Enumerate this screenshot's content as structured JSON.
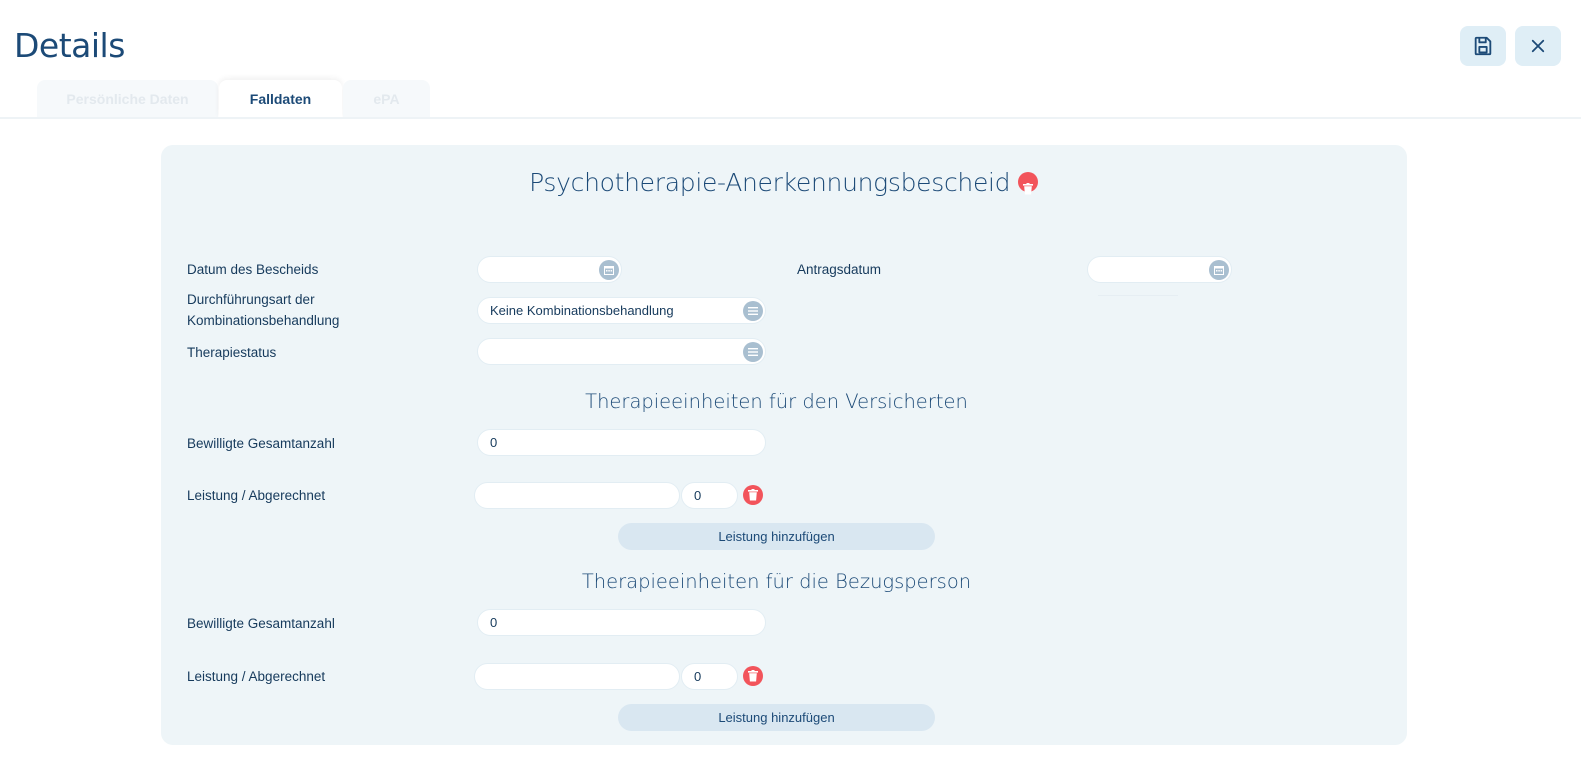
{
  "header": {
    "title": "Details",
    "save_icon": "save-icon",
    "close_icon": "close-icon"
  },
  "tabs": [
    {
      "label": "Persönliche Daten",
      "active": false
    },
    {
      "label": "Falldaten",
      "active": true
    },
    {
      "label": "ePA",
      "active": false
    }
  ],
  "form": {
    "title": "Psychotherapie-Anerkennungsbescheid",
    "fields": {
      "datum_label": "Datum des Bescheids",
      "datum_value": "",
      "antrag_label": "Antragsdatum",
      "antrag_value": "",
      "durchfuehrung_label_1": "Durchführungsart der",
      "durchfuehrung_label_2": "Kombinationsbehandlung",
      "durchfuehrung_value": "Keine Kombinationsbehandlung",
      "status_label": "Therapiestatus",
      "status_value": ""
    },
    "section_versicherte": {
      "title": "Therapieeinheiten für den Versicherten",
      "gesamt_label": "Bewilligte Gesamtanzahl",
      "gesamt_value": "0",
      "leistung_label": "Leistung / Abgerechnet",
      "leistung_value": "",
      "abgerechnet_value": "0",
      "add_label": "Leistung hinzufügen"
    },
    "section_bezugsperson": {
      "title": "Therapieeinheiten für die Bezugsperson",
      "gesamt_label": "Bewilligte Gesamtanzahl",
      "gesamt_value": "0",
      "leistung_label": "Leistung / Abgerechnet",
      "leistung_value": "",
      "abgerechnet_value": "0",
      "add_label": "Leistung hinzufügen"
    }
  },
  "colors": {
    "accent": "#1c4a77",
    "panel_bg": "#eef5f8",
    "danger": "#f2545b",
    "icon_bg": "#a9bfd0"
  }
}
